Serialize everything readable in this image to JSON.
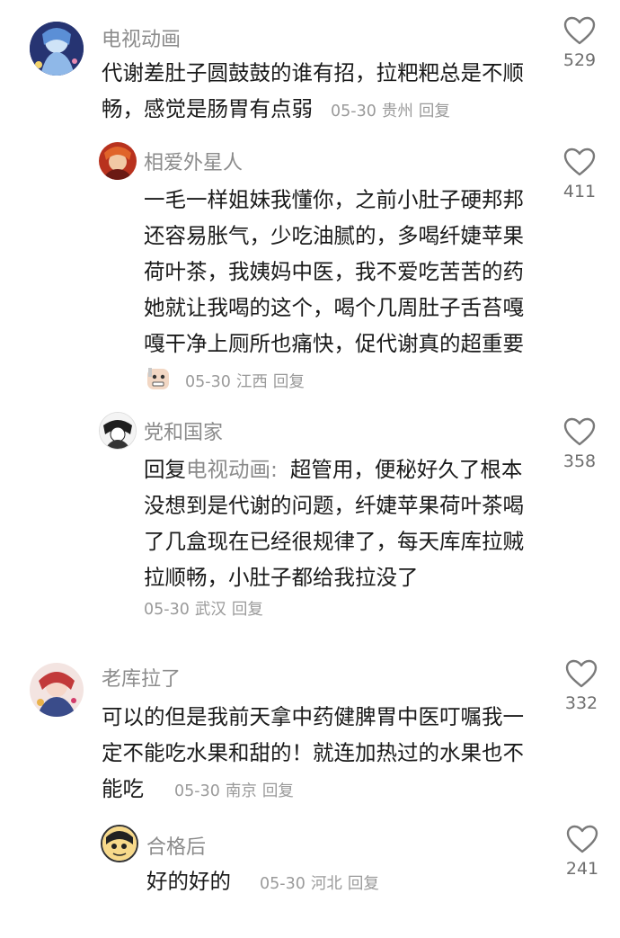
{
  "comments": [
    {
      "username": "电视动画",
      "text": "代谢差肚子圆鼓鼓的谁有招，拉粑粑总是不顺畅，感觉是肠胃有点弱",
      "date": "05-30",
      "location": "贵州",
      "reply_label": "回复",
      "likes": "529"
    },
    {
      "username": "相爱外星人",
      "text": "一毛一样姐妹我懂你，之前小肚子硬邦邦还容易胀气，少吃油腻的，多喝纤婕苹果荷叶茶，我姨妈中医，我不爱吃苦苦的药她就让我喝的这个，喝个几周肚子舌苔嘎嘎干净上厕所也痛快，促代谢真的超重要",
      "date": "05-30",
      "location": "江西",
      "reply_label": "回复",
      "likes": "411"
    },
    {
      "username": "党和国家",
      "reply_prefix": "回复",
      "reply_to": "电视动画:",
      "text": "超管用，便秘好久了根本没想到是代谢的问题，纤婕苹果荷叶茶喝了几盒现在已经很规律了，每天库库拉贼拉顺畅，小肚子都给我拉没了",
      "date": "05-30",
      "location": "武汉",
      "reply_label": "回复",
      "likes": "358"
    },
    {
      "username": "老库拉了",
      "text": "可以的但是我前天拿中药健脾胃中医叮嘱我一定不能吃水果和甜的！就连加热过的水果也不能吃",
      "date": "05-30",
      "location": "南京",
      "reply_label": "回复",
      "likes": "332"
    },
    {
      "username": "合格后",
      "text": "好的好的",
      "date": "05-30",
      "location": "河北",
      "reply_label": "回复",
      "likes": "241"
    }
  ],
  "colors": {
    "username": "#8b8b8b",
    "text": "#1a1a1a",
    "meta": "#9a9a9a",
    "like_icon": "#7a7a7a"
  },
  "icons": {
    "like": "heart-outline-icon",
    "emoji": "grimace-face-emoji"
  }
}
